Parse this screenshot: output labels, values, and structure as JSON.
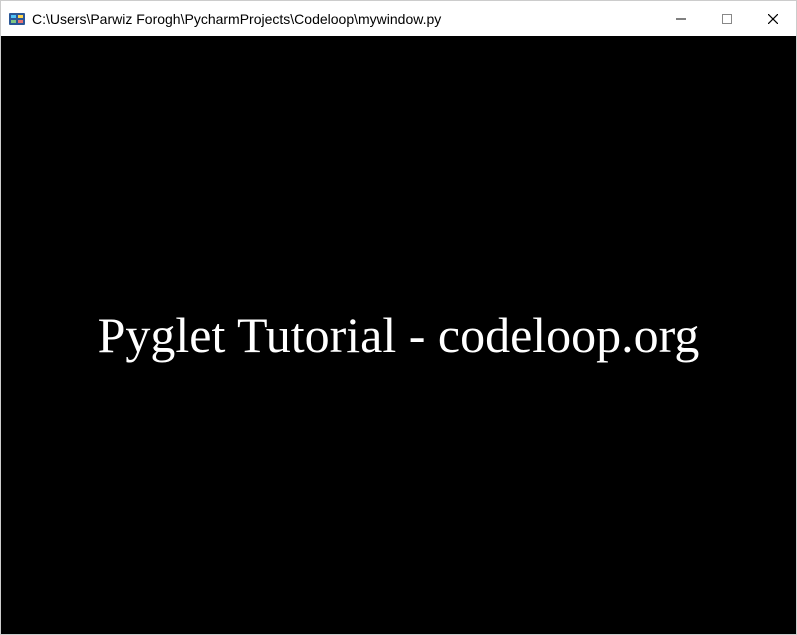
{
  "titlebar": {
    "title": "C:\\Users\\Parwiz Forogh\\PycharmProjects\\Codeloop\\mywindow.py"
  },
  "content": {
    "label": "Pyglet Tutorial - codeloop.org"
  }
}
